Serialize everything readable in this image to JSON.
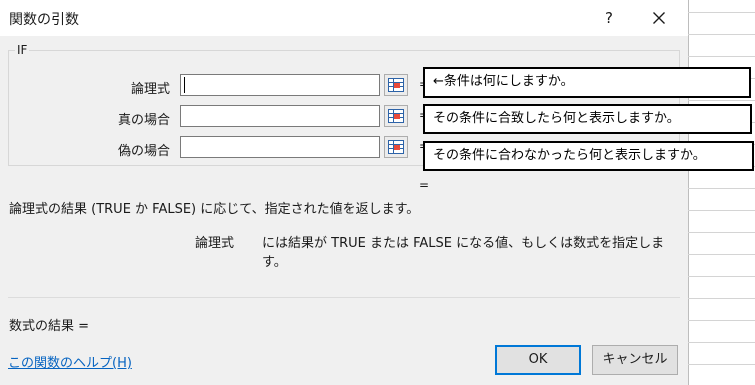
{
  "dialog": {
    "title": "関数の引数",
    "help_button": "?",
    "function_name": "IF"
  },
  "arguments": [
    {
      "label": "論理式",
      "value": "",
      "equals": "="
    },
    {
      "label": "真の場合",
      "value": "",
      "equals": "="
    },
    {
      "label": "偽の場合",
      "value": "",
      "equals": "="
    }
  ],
  "result_equals": "=",
  "annotations": [
    "←条件は何にしますか。",
    "その条件に合致したら何と表示しますか。",
    "その条件に合わなかったら何と表示しますか。"
  ],
  "description": {
    "summary": "論理式の結果 (TRUE か FALSE) に応じて、指定された値を返します。",
    "arg_name": "論理式",
    "arg_help": "には結果が TRUE または FALSE になる値、もしくは数式を指定します。"
  },
  "formula_result": "数式の結果 =",
  "help_link": "この関数のヘルプ(H)",
  "buttons": {
    "ok": "OK",
    "cancel": "キャンセル"
  },
  "icons": {
    "close": "close-icon",
    "ref": "range-select-icon"
  }
}
